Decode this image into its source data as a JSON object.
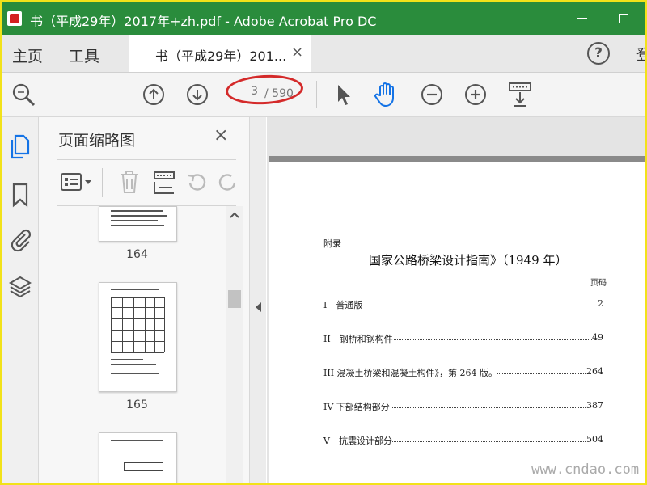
{
  "window": {
    "title": "书（平成29年）2017年+zh.pdf - Adobe Acrobat Pro DC"
  },
  "tabs": {
    "home": "主页",
    "tools": "工具",
    "document": "书（平成29年）201...",
    "close": "×",
    "help": "?",
    "signin": "登"
  },
  "toolbar": {
    "current_page": "3",
    "total_pages": "/ 590"
  },
  "icons": {
    "left_rail": [
      "pages-icon",
      "bookmark-icon",
      "attachment-icon",
      "layers-icon"
    ]
  },
  "panel": {
    "title": "页面缩略图",
    "close": "×",
    "thumbnails": [
      {
        "number": "164"
      },
      {
        "number": "165"
      }
    ]
  },
  "document": {
    "appendix_label": "附录",
    "heading": "国家公路桥梁设计指南》（1949 年）",
    "page_column": "页码",
    "toc": [
      {
        "label": "I　普通版",
        "page": "2"
      },
      {
        "label": "II　钢桥和钢构件",
        "page": "49"
      },
      {
        "label": "III 混凝土桥梁和混凝土构件》，第 264 版。",
        "page": "264"
      },
      {
        "label": "IV 下部结构部分",
        "page": "387"
      },
      {
        "label": "V　抗震设计部分",
        "page": "504"
      }
    ]
  },
  "watermark": "www.cndao.com",
  "colors": {
    "titlebar": "#2a8c3c",
    "frame": "#f2e21a",
    "accent_hand": "#1473e6",
    "annotation": "#d42a2a"
  }
}
